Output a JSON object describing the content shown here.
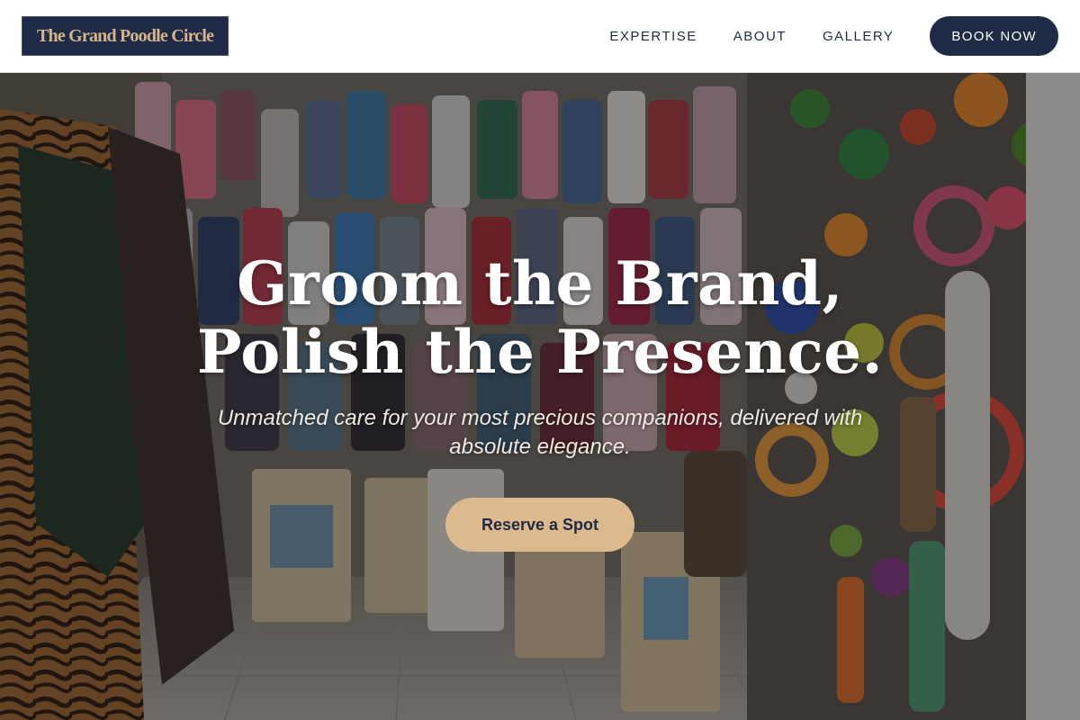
{
  "header": {
    "logo_text": "The Grand Poodle Circle",
    "nav": [
      {
        "label": "EXPERTISE"
      },
      {
        "label": "ABOUT"
      },
      {
        "label": "GALLERY"
      }
    ],
    "book_label": "BOOK NOW"
  },
  "hero": {
    "headline": "Groom the Brand, Polish the Presence.",
    "subtitle": "Unmatched care for your most precious companions, delivered with absolute elegance.",
    "cta_label": "Reserve a Spot",
    "background_image": "pet-shop-interior-photo"
  },
  "colors": {
    "navy": "#1f2a44",
    "gold": "#d4b48c",
    "cta": "#dcba8e"
  }
}
